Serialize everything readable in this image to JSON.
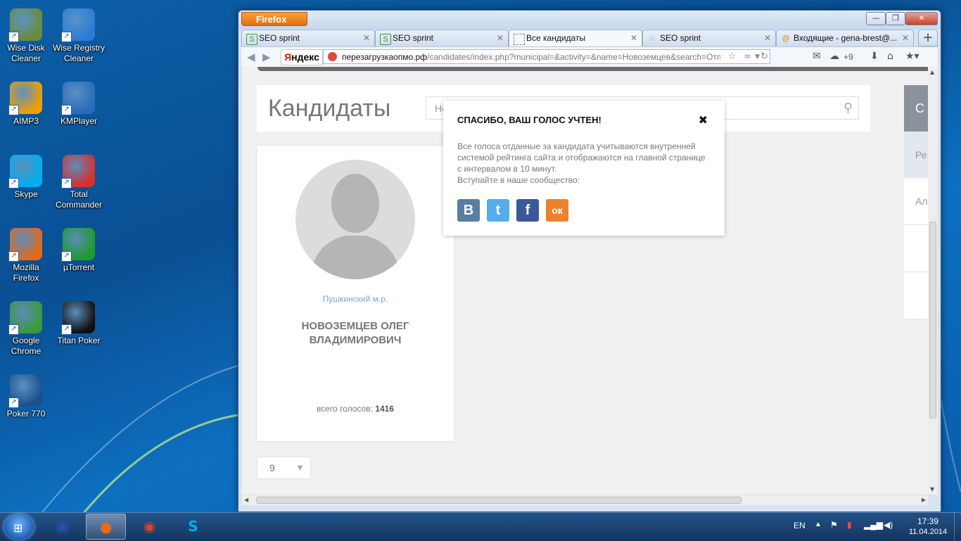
{
  "desktop": {
    "icons": [
      {
        "label": "Wise Disk Cleaner",
        "icon": "wise-disk-cleaner-icon",
        "color": "#6a8b3a"
      },
      {
        "label": "Wise Registry Cleaner",
        "icon": "wise-registry-cleaner-icon",
        "color": "#2c7bd6"
      },
      {
        "label": "AIMP3",
        "icon": "aimp3-icon",
        "color": "#f2a000"
      },
      {
        "label": "KMPlayer",
        "icon": "kmplayer-icon",
        "color": "#2a6bbd"
      },
      {
        "label": "Skype",
        "icon": "skype-icon",
        "color": "#00aff0"
      },
      {
        "label": "Total Commander",
        "icon": "total-commander-icon",
        "color": "#d43030"
      },
      {
        "label": "Mozilla Firefox",
        "icon": "firefox-icon",
        "color": "#e66a16"
      },
      {
        "label": "µTorrent",
        "icon": "utorrent-icon",
        "color": "#1d9b2c"
      },
      {
        "label": "Google Chrome",
        "icon": "chrome-icon",
        "color": "#3a9a3a"
      },
      {
        "label": "Titan Poker",
        "icon": "titan-poker-icon",
        "color": "#111111"
      },
      {
        "label": "Poker 770",
        "icon": "poker770-icon",
        "color": "#1a4f8c"
      }
    ]
  },
  "browser": {
    "menu_label": "Firefox",
    "tabs": [
      {
        "label": "SEO sprint",
        "active": false
      },
      {
        "label": "SEO sprint",
        "active": false
      },
      {
        "label": "Все кандидаты",
        "active": true
      },
      {
        "label": "SEO sprint",
        "active": false
      },
      {
        "label": "Входящие - gena-brest@...",
        "active": false
      }
    ],
    "yandex_label_y": "Я",
    "yandex_label_rest": "ндекс",
    "url_host": "перезагрузкаопмо.рф",
    "url_path": "/candidates/index.php?municipal=&activity=&name=Новоземцев&search=Отправи",
    "weather": "+9"
  },
  "page": {
    "title": "Кандидаты",
    "search_value": "Не",
    "right_panel": {
      "dark": "С",
      "blue": "Ре",
      "row1": "Ал"
    },
    "candidate": {
      "district": "Пушкинский м.р.",
      "name": "НОВОЗЕМЦЕВ ОЛЕГ ВЛАДИМИРОВИЧ",
      "votes_label": "всего голосов:",
      "votes_value": "1416"
    },
    "pager_value": "9"
  },
  "modal": {
    "title": "СПАСИБО, ВАШ ГОЛОС УЧТЕН!",
    "body": "Все голоса отданные за кандидата учитываются внутренней системой рейтинга сайта и отображаются на главной странице с интервалом в 10 минут.",
    "join": "Вступайте в наше сообщество:",
    "social": [
      {
        "name": "vk",
        "glyph": "В",
        "color": "#597da3"
      },
      {
        "name": "twitter",
        "glyph": "t",
        "color": "#55acee"
      },
      {
        "name": "facebook",
        "glyph": "f",
        "color": "#3b5998"
      },
      {
        "name": "odnoklassniki",
        "glyph": "ок",
        "color": "#ed812b"
      }
    ]
  },
  "taskbar": {
    "lang": "EN",
    "time": "17:39",
    "date": "11.04.2014"
  }
}
